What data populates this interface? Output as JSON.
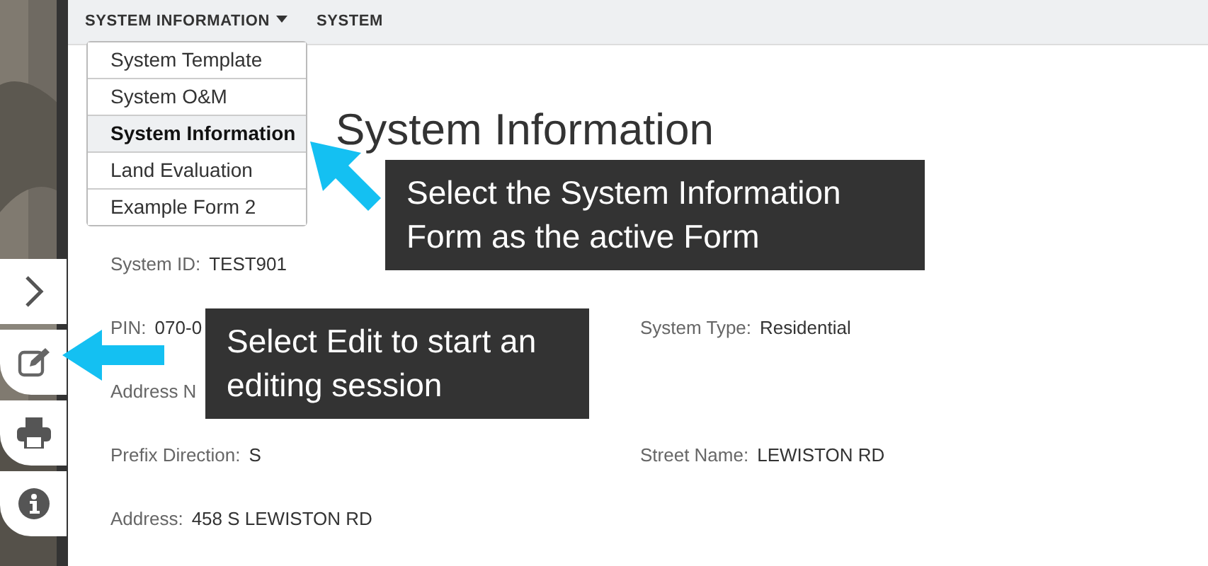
{
  "menubar": [
    {
      "label": "SYSTEM INFORMATION",
      "dropdown": true
    },
    {
      "label": "SYSTEM",
      "dropdown": false
    }
  ],
  "dropdown": [
    {
      "label": "System Template",
      "selected": false
    },
    {
      "label": "System O&M",
      "selected": false
    },
    {
      "label": "System Information",
      "selected": true
    },
    {
      "label": "Land Evaluation",
      "selected": false
    },
    {
      "label": "Example Form 2",
      "selected": false
    }
  ],
  "side_tabs": [
    {
      "kind": "expand"
    },
    {
      "kind": "edit"
    },
    {
      "kind": "print"
    },
    {
      "kind": "info"
    }
  ],
  "title": "System Information",
  "rows": [
    {
      "left": {
        "label": "System ID:",
        "value": "TEST901"
      }
    },
    {
      "left": {
        "label": "PIN:",
        "value": "070-0"
      },
      "right": {
        "label": "System Type:",
        "value": "Residential"
      }
    },
    {
      "left": {
        "label": "Address N"
      }
    },
    {
      "left": {
        "label": "Prefix Direction:",
        "value": "S"
      },
      "right": {
        "label": "Street Name:",
        "value": "LEWISTON RD"
      }
    },
    {
      "left": {
        "label": "Address:",
        "value": "458 S LEWISTON RD"
      }
    }
  ],
  "callouts": [
    {
      "text": "Select the System Information Form as the active Form"
    },
    {
      "text": "Select Edit to start an editing session"
    }
  ]
}
